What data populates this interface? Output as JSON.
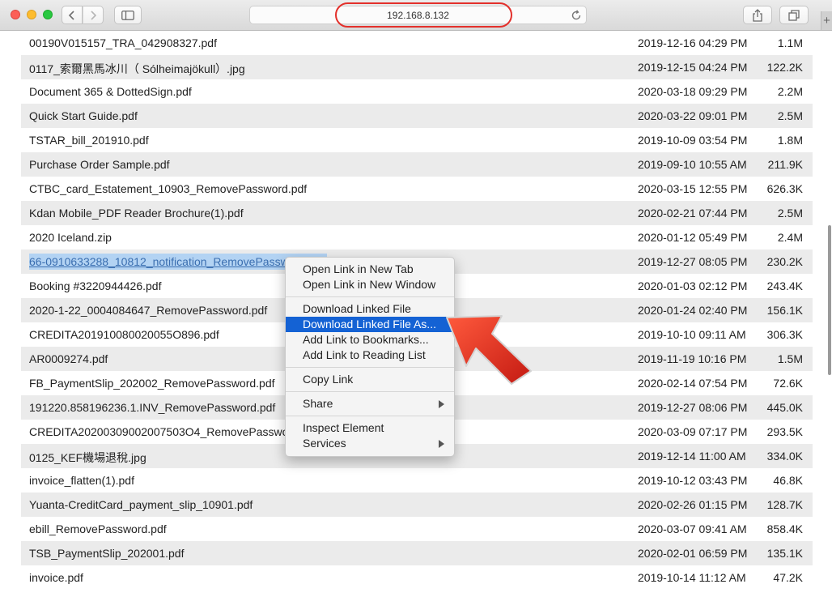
{
  "browser": {
    "address": "192.168.8.132",
    "icons": {
      "back": "chevron-left-icon",
      "forward": "chevron-right-icon",
      "sidebar": "sidebar-icon",
      "reload": "reload-icon",
      "share": "share-icon",
      "tabs": "tabs-overview-icon",
      "new_tab": "+"
    }
  },
  "files": [
    {
      "name": "00190V015157_TRA_042908327.pdf",
      "date": "2019-12-16 04:29 PM",
      "size": "1.1M"
    },
    {
      "name": "0117_索爾黑馬冰川（ Sólheimajökull）.jpg",
      "date": "2019-12-15 04:24 PM",
      "size": "122.2K"
    },
    {
      "name": "Document 365 & DottedSign.pdf",
      "date": "2020-03-18 09:29 PM",
      "size": "2.2M"
    },
    {
      "name": "Quick Start Guide.pdf",
      "date": "2020-03-22 09:01 PM",
      "size": "2.5M"
    },
    {
      "name": "TSTAR_bill_201910.pdf",
      "date": "2019-10-09 03:54 PM",
      "size": "1.8M"
    },
    {
      "name": "Purchase Order Sample.pdf",
      "date": "2019-09-10 10:55 AM",
      "size": "211.9K"
    },
    {
      "name": "CTBC_card_Estatement_10903_RemovePassword.pdf",
      "date": "2020-03-15 12:55 PM",
      "size": "626.3K"
    },
    {
      "name": "Kdan Mobile_PDF Reader Brochure(1).pdf",
      "date": "2020-02-21 07:44 PM",
      "size": "2.5M"
    },
    {
      "name": "2020 Iceland.zip",
      "date": "2020-01-12 05:49 PM",
      "size": "2.4M"
    },
    {
      "name": "66-0910633288_10812_notification_RemovePassword.pdf",
      "date": "2019-12-27 08:05 PM",
      "size": "230.2K",
      "selected": true
    },
    {
      "name": "Booking #3220944426.pdf",
      "date": "2020-01-03 02:12 PM",
      "size": "243.4K"
    },
    {
      "name": "2020-1-22_0004084647_RemovePassword.pdf",
      "date": "2020-01-24 02:40 PM",
      "size": "156.1K"
    },
    {
      "name": "CREDITA201910080020055O896.pdf",
      "date": "2019-10-10 09:11 AM",
      "size": "306.3K"
    },
    {
      "name": "AR0009274.pdf",
      "date": "2019-11-19 10:16 PM",
      "size": "1.5M"
    },
    {
      "name": "FB_PaymentSlip_202002_RemovePassword.pdf",
      "date": "2020-02-14 07:54 PM",
      "size": "72.6K"
    },
    {
      "name": "191220.858196236.1.INV_RemovePassword.pdf",
      "date": "2019-12-27 08:06 PM",
      "size": "445.0K"
    },
    {
      "name": "CREDITA20200309002007503O4_RemovePassword.pdf",
      "date": "2020-03-09 07:17 PM",
      "size": "293.5K"
    },
    {
      "name": "0125_KEF機場退稅.jpg",
      "date": "2019-12-14 11:00 AM",
      "size": "334.0K"
    },
    {
      "name": "invoice_flatten(1).pdf",
      "date": "2019-10-12 03:43 PM",
      "size": "46.8K"
    },
    {
      "name": "Yuanta-CreditCard_payment_slip_10901.pdf",
      "date": "2020-02-26 01:15 PM",
      "size": "128.7K"
    },
    {
      "name": "ebill_RemovePassword.pdf",
      "date": "2020-03-07 09:41 AM",
      "size": "858.4K"
    },
    {
      "name": "TSB_PaymentSlip_202001.pdf",
      "date": "2020-02-01 06:59 PM",
      "size": "135.1K"
    },
    {
      "name": "invoice.pdf",
      "date": "2019-10-14 11:12 AM",
      "size": "47.2K"
    }
  ],
  "context_menu": {
    "groups": [
      [
        {
          "label": "Open Link in New Tab"
        },
        {
          "label": "Open Link in New Window"
        }
      ],
      [
        {
          "label": "Download Linked File"
        },
        {
          "label": "Download Linked File As...",
          "active": true
        },
        {
          "label": "Add Link to Bookmarks..."
        },
        {
          "label": "Add Link to Reading List"
        }
      ],
      [
        {
          "label": "Copy Link"
        }
      ],
      [
        {
          "label": "Share",
          "submenu": true
        }
      ],
      [
        {
          "label": "Inspect Element"
        },
        {
          "label": "Services",
          "submenu": true
        }
      ]
    ]
  },
  "colors": {
    "highlight_oval": "#e3302b",
    "arrow": "#e8271f",
    "menu_active": "#1462d4",
    "selection": "#b3d3f3",
    "row_alt": "#ebebeb"
  }
}
